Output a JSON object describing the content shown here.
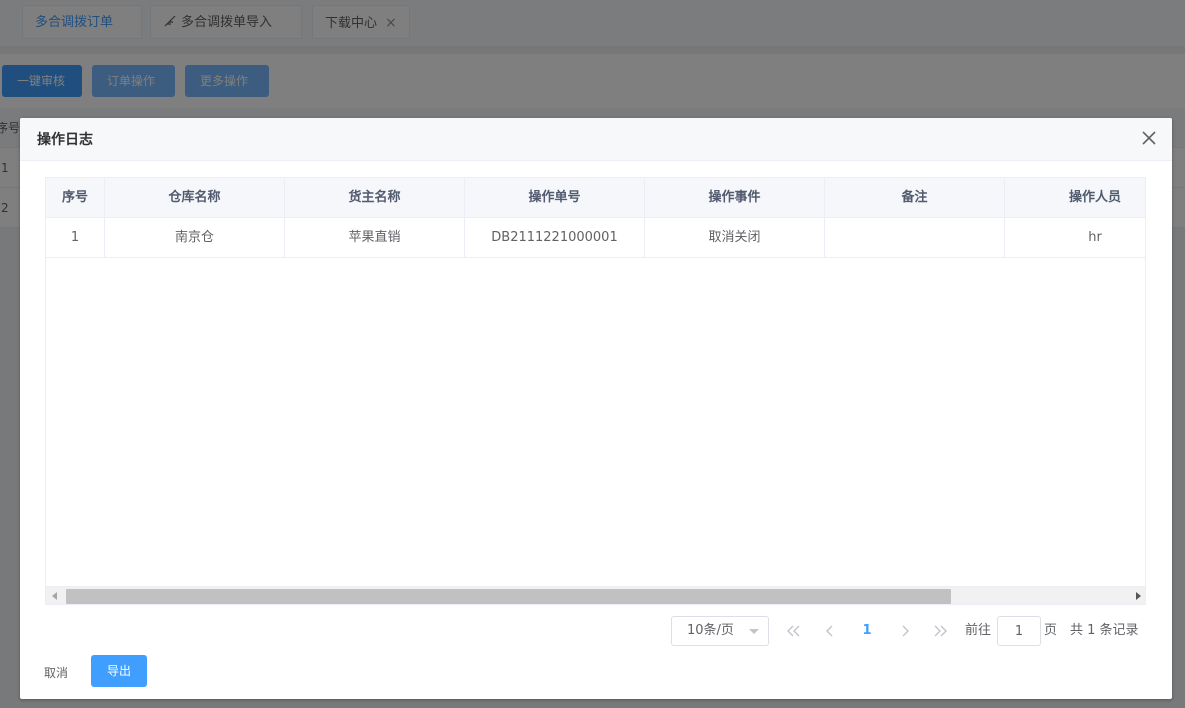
{
  "tabs": [
    {
      "label": "多合调拨订单",
      "active": true,
      "icon": ""
    },
    {
      "label": "多合调拨单导入",
      "active": false,
      "icon": "feather-pen-icon"
    },
    {
      "label": "下载中心",
      "active": false,
      "icon": ""
    }
  ],
  "tab_close_glyph": "×",
  "toolbar": {
    "audit_label": "一键审核",
    "order_ops_label": "订单操作",
    "more_ops_label": "更多操作"
  },
  "background_table": {
    "header_fragment": "序号",
    "rows": [
      "1",
      "2"
    ]
  },
  "dialog": {
    "title": "操作日志",
    "columns": [
      "序号",
      "仓库名称",
      "货主名称",
      "操作单号",
      "操作事件",
      "备注",
      "操作人员"
    ],
    "rows": [
      [
        "1",
        "南京仓",
        "苹果直销",
        "DB2111221000001",
        "取消关闭",
        "",
        "hr"
      ]
    ],
    "pagination": {
      "page_size": "10条/页",
      "current_page": "1",
      "goto_prefix": "前往",
      "goto_value": "1",
      "goto_suffix": "页",
      "total": "共 1 条记录"
    },
    "footer": {
      "cancel_label": "取消",
      "export_label": "导出"
    }
  },
  "colors": {
    "primary": "#409eff",
    "primary_light": "#79bbff",
    "overlay": "rgba(0,0,0,0.5)"
  }
}
